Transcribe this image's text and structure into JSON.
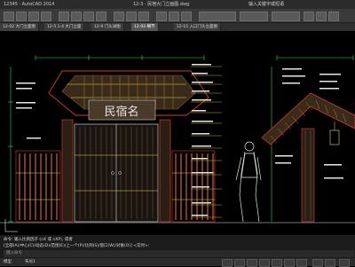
{
  "window": {
    "title_left": "12345 · AutoCAD 2014",
    "title_center": "12-3 · 民宿大门立面图.dwg",
    "title_right": "输入关键字或短语"
  },
  "tabs": [
    {
      "label": "12-02 大门立面图",
      "active": false
    },
    {
      "label": "12-5 1-4 大门立面",
      "active": false
    },
    {
      "label": "12-9 门头详图",
      "active": false
    },
    {
      "label": "12-02 细节",
      "active": true
    },
    {
      "label": "12-15 入口门头立面图",
      "active": false
    }
  ],
  "drawing": {
    "sign_text": "民宿名"
  },
  "command": {
    "line1": "命令: 输入比例因子 (nX 或 nXP), 或者",
    "line2": "[全部(A)/中心(C)/动态(D)/范围(E)/上一个(P)/比例(S)/窗口(W)/对象(O)] <实时>:",
    "prompt": "键入命令"
  },
  "status": {
    "model_tab": "模型",
    "layout_tab": "布局1"
  },
  "colors": {
    "cad_yellow": "#e8d84a",
    "cad_red": "#d23a2a",
    "cad_green": "#3fd05a",
    "cad_white": "#e6e6e6",
    "cad_cyan": "#4fd8e0"
  }
}
